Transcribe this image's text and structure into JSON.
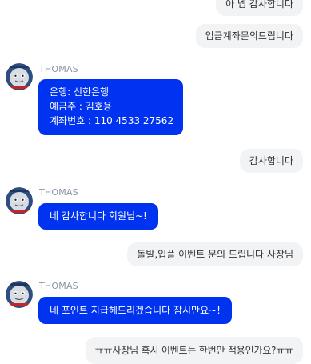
{
  "sender_name": "THOMAS",
  "avatar_icon": "thomas-train-avatar-icon",
  "messages": {
    "m1": "아 넵 감사합니다",
    "m2": "입금계좌문의드립니다",
    "m3_line1": "은행: 신한은행",
    "m3_line2": "예금주 : 김호용",
    "m3_line3": "계좌번호 : 110 4533 27562",
    "m4": "감사합니다",
    "m5": "네 감사합니다 회원님~!",
    "m6": "돌발,입플 이벤트 문의 드립니다 사장님",
    "m7": "네 포인트 지급헤드리겠습니다 잠시만요~!",
    "m8": "ㅠㅠ사장님 혹시 이벤트는 한번만 적용인가요?ㅠㅠ"
  },
  "colors": {
    "incoming_bubble": "#0033f0",
    "outgoing_bubble": "#f2f3f5",
    "sender_text": "#8a93a6"
  }
}
